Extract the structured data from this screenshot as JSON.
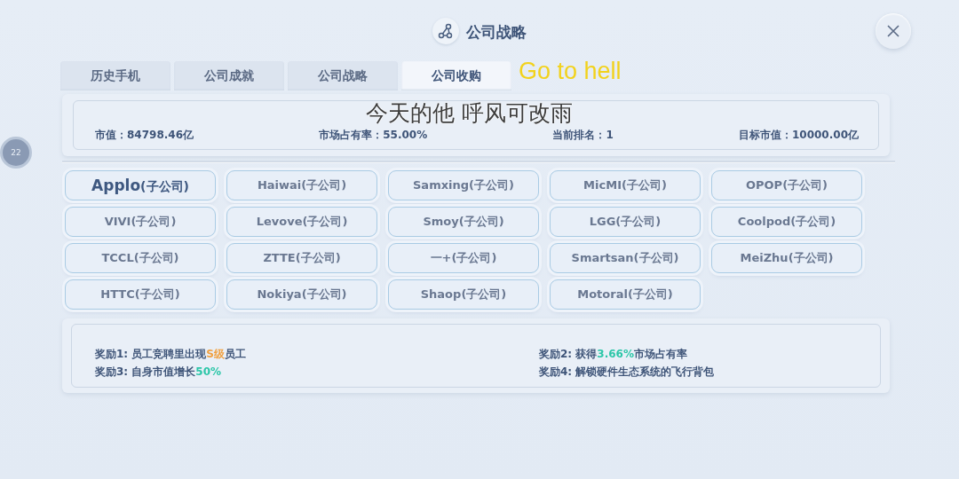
{
  "header": {
    "title": "公司战略"
  },
  "side_badge": {
    "label": "22"
  },
  "tabs": [
    {
      "label": "历史手机",
      "selected": false
    },
    {
      "label": "公司成就",
      "selected": false
    },
    {
      "label": "公司战略",
      "selected": false
    },
    {
      "label": "公司收购",
      "selected": true
    }
  ],
  "stats": [
    {
      "label": "市值：84798.46亿"
    },
    {
      "label": "市场占有率：55.00%"
    },
    {
      "label": "当前排名：1"
    },
    {
      "label": "目标市值：10000.00亿"
    }
  ],
  "companies": [
    {
      "name": "Applo",
      "suffix": "(子公司)",
      "selected": true
    },
    {
      "name": "Haiwai",
      "suffix": "(子公司)",
      "selected": false
    },
    {
      "name": "Samxing",
      "suffix": "(子公司)",
      "selected": false
    },
    {
      "name": "MicMI",
      "suffix": "(子公司)",
      "selected": false
    },
    {
      "name": "OPOP",
      "suffix": "(子公司)",
      "selected": false
    },
    {
      "name": "VIVI",
      "suffix": "(子公司)",
      "selected": false
    },
    {
      "name": "Levove",
      "suffix": "(子公司)",
      "selected": false
    },
    {
      "name": "Smoy",
      "suffix": "(子公司)",
      "selected": false
    },
    {
      "name": "LGG",
      "suffix": "(子公司)",
      "selected": false
    },
    {
      "name": "Coolpod",
      "suffix": "(子公司)",
      "selected": false
    },
    {
      "name": "TCCL",
      "suffix": "(子公司)",
      "selected": false
    },
    {
      "name": "ZTTE",
      "suffix": "(子公司)",
      "selected": false
    },
    {
      "name": "一+",
      "suffix": "(子公司)",
      "selected": false
    },
    {
      "name": "Smartsan",
      "suffix": "(子公司)",
      "selected": false
    },
    {
      "name": "MeiZhu",
      "suffix": "(子公司)",
      "selected": false
    },
    {
      "name": "HTTC",
      "suffix": "(子公司)",
      "selected": false
    },
    {
      "name": "Nokiya",
      "suffix": "(子公司)",
      "selected": false
    },
    {
      "name": "Shaop",
      "suffix": "(子公司)",
      "selected": false
    },
    {
      "name": "Motoral",
      "suffix": "(子公司)",
      "selected": false
    }
  ],
  "rewards": [
    {
      "parts": [
        {
          "text": "奖励1: 员工竞聘里出现"
        },
        {
          "text": "S级",
          "color": "#f0a040"
        },
        {
          "text": "员工"
        }
      ]
    },
    {
      "parts": [
        {
          "text": "奖励2: 获得"
        },
        {
          "text": "3.66%",
          "color": "#2cc6a8"
        },
        {
          "text": "市场占有率"
        }
      ]
    },
    {
      "parts": [
        {
          "text": "奖励3: 自身市值增长"
        },
        {
          "text": "50%",
          "color": "#2cc6a8"
        }
      ]
    },
    {
      "parts": [
        {
          "text": "奖励4: 解锁硬件生态系统的飞行背包"
        }
      ]
    }
  ],
  "overlays": {
    "caption_top": "Go to hell",
    "subtitle": "今天的他 呼风可改雨"
  }
}
